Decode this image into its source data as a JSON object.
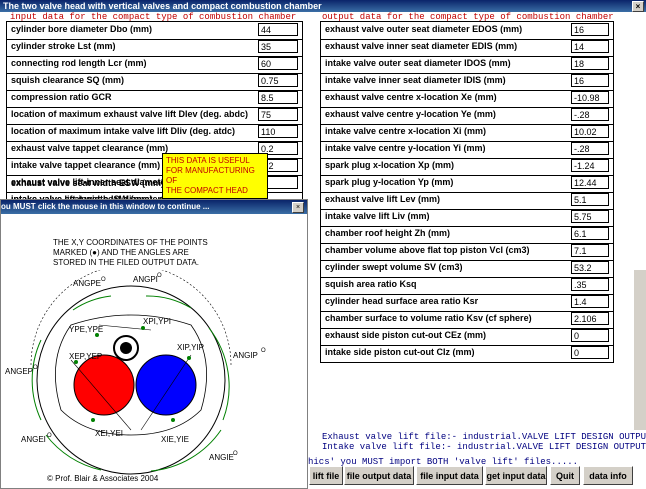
{
  "window": {
    "title": "The two valve head with vertical valves and compact combustion chamber",
    "close_glyph": "×"
  },
  "input_panel": {
    "header": "input data for the compact type of combustion chamber",
    "rows": [
      {
        "label": "cylinder bore diameter Dbo (mm)",
        "value": "44"
      },
      {
        "label": "cylinder stroke Lst (mm)",
        "value": "35"
      },
      {
        "label": "connecting rod length Lcr (mm)",
        "value": "60"
      },
      {
        "label": "squish clearance SQ (mm)",
        "value": "0.75"
      },
      {
        "label": "compression ratio GCR",
        "value": "8.5"
      },
      {
        "label": "location of maximum exhaust valve lift Dlev (deg. abdc)",
        "value": "75"
      },
      {
        "label": "location of maximum intake valve lift Dliv (deg. atdc)",
        "value": "110"
      },
      {
        "label": "exhaust valve tappet clearance (mm)",
        "value": "0.2"
      },
      {
        "label": "intake valve tappet clearance (mm)",
        "value": "0.2"
      },
      {
        "label": "exhaust valve lift-inner seat diameter",
        "value": ""
      },
      {
        "label": "intake valve lift-inner seat diameter",
        "value": ""
      },
      {
        "label": "exhaust valve seat width ESW (mm)",
        "value": ""
      },
      {
        "label": "intake valve seat width ISW (mm)",
        "value": ""
      }
    ]
  },
  "output_panel": {
    "header": "output data for the compact type of combustion chamber",
    "rows": [
      {
        "label": "exhaust valve outer seat diameter EDOS (mm)",
        "value": "16"
      },
      {
        "label": "exhaust valve inner seat diameter EDIS (mm)",
        "value": "14"
      },
      {
        "label": "intake valve outer seat diameter IDOS (mm)",
        "value": "18"
      },
      {
        "label": "intake valve inner seat diameter IDIS (mm)",
        "value": "16"
      },
      {
        "label": "exhaust valve centre x-location Xe (mm)",
        "value": "-10.98"
      },
      {
        "label": "exhaust valve centre y-location Ye (mm)",
        "value": "-.28"
      },
      {
        "label": "intake valve centre x-location Xi (mm)",
        "value": "10.02"
      },
      {
        "label": "intake valve centre y-location Yi (mm)",
        "value": "-.28"
      },
      {
        "label": "spark plug x-location Xp (mm)",
        "value": "-1.24"
      },
      {
        "label": "spark plug y-location Yp (mm)",
        "value": "12.44"
      },
      {
        "label": "exhaust valve lift Lev (mm)",
        "value": "5.1"
      },
      {
        "label": "intake valve lift Liv (mm)",
        "value": "5.75"
      },
      {
        "label": "chamber roof height Zh (mm)",
        "value": "6.1"
      },
      {
        "label": "chamber volume above flat top piston Vcl (cm3)",
        "value": "7.1"
      },
      {
        "label": "cylinder swept volume SV (cm3)",
        "value": "53.2"
      },
      {
        "label": "squish area ratio Ksq",
        "value": ".35"
      },
      {
        "label": "cylinder head surface area ratio Ksr",
        "value": "1.4"
      },
      {
        "label": "chamber surface to volume ratio Ksv (cf sphere)",
        "value": "2.106"
      },
      {
        "label": "exhaust side piston cut-out CEz (mm)",
        "value": "0"
      },
      {
        "label": "intake side piston cut-out CIz (mm)",
        "value": "0"
      }
    ]
  },
  "note": {
    "line1": "THIS DATA IS USEFUL",
    "line2": "FOR MANUFACTURING OF",
    "line3": "THE  COMPACT HEAD"
  },
  "diagram": {
    "title": "ou MUST click the mouse in this window to continue ...",
    "coord_line1": "THE X,Y COORDINATES OF THE POINTS",
    "coord_line2": "MARKED (●) AND THE ANGLES ARE",
    "coord_line3": "STORED IN THE FILED OUTPUT DATA.",
    "labels": {
      "angpe": "ANGPE",
      "angpi": "ANGPI",
      "angip": "ANGIP",
      "angep": "ANGEP",
      "angei": "ANGEI",
      "angie": "ANGIE",
      "deg": "O",
      "ype": "YPE,YPE",
      "xpi": "XPI,YPI",
      "xep": "XEP,YEP",
      "xip": "XIP,YIP",
      "xei": "XEI,YEI",
      "xie": "XIE,YIE"
    },
    "copyright": "© Prof. Blair & Associates 2004",
    "colors": {
      "exhaust": "#ff0000",
      "intake": "#0000ff",
      "arc": "#008000"
    }
  },
  "file_lines": {
    "exhaust_prefix": "Exhaust valve lift file:-",
    "exhaust_file": "industrial.VALVE LIFT DESIGN OUTPUT",
    "intake_prefix": "Intake valve lift file:-",
    "intake_file": "industrial.VALVE LIFT DESIGN OUTPUT"
  },
  "bottom_hint": "hics' you MUST import BOTH 'valve lift' files.....",
  "buttons": {
    "lift_file": "lift file",
    "file_output": "file output data",
    "file_input": "file input data",
    "get_input": "get input data",
    "quit": "Quit",
    "data_info": "data info"
  }
}
